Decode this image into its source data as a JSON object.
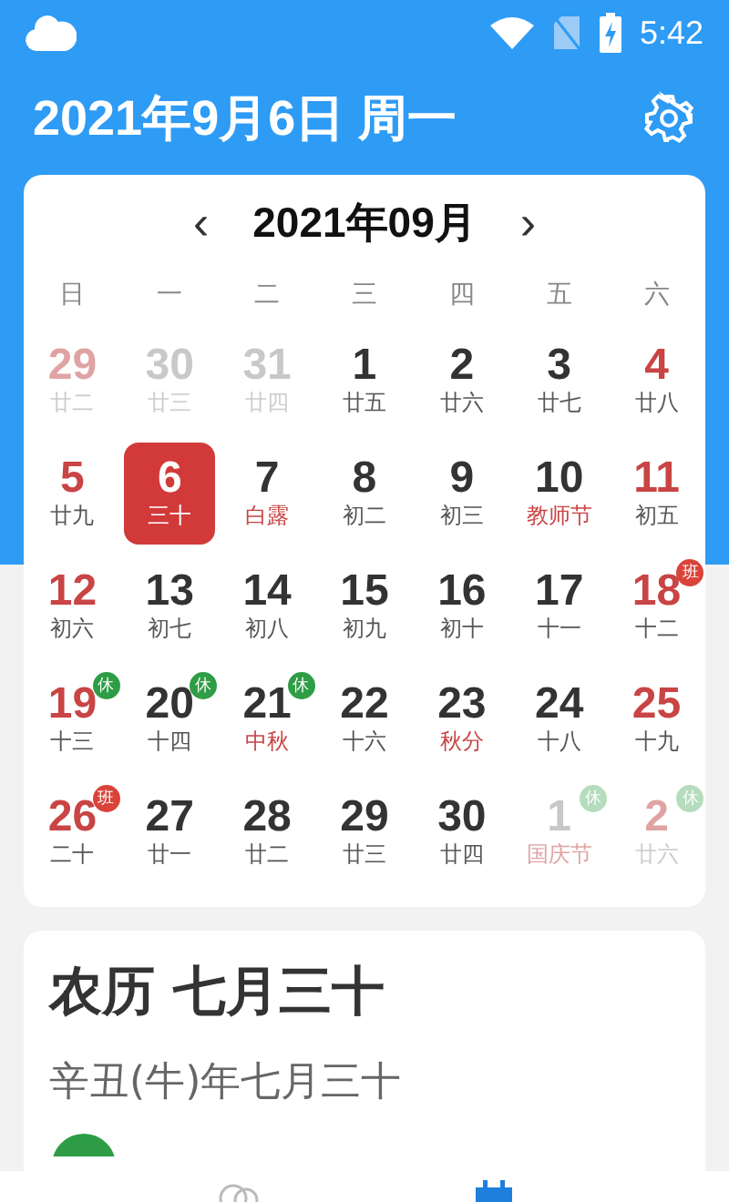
{
  "status_bar": {
    "time": "5:42"
  },
  "header": {
    "title": "2021年9月6日 周一"
  },
  "calendar": {
    "prev": "‹",
    "month": "2021年09月",
    "next": "›",
    "weekdays": [
      "日",
      "一",
      "二",
      "三",
      "四",
      "五",
      "六"
    ],
    "weeks": [
      [
        {
          "day": "29",
          "lunar": "廿二",
          "other_month": true,
          "holiday": true,
          "festival": false,
          "selected": false
        },
        {
          "day": "30",
          "lunar": "廿三",
          "other_month": true,
          "holiday": false,
          "festival": false,
          "selected": false
        },
        {
          "day": "31",
          "lunar": "廿四",
          "other_month": true,
          "holiday": false,
          "festival": false,
          "selected": false
        },
        {
          "day": "1",
          "lunar": "廿五",
          "other_month": false,
          "holiday": false,
          "festival": false,
          "selected": false
        },
        {
          "day": "2",
          "lunar": "廿六",
          "other_month": false,
          "holiday": false,
          "festival": false,
          "selected": false
        },
        {
          "day": "3",
          "lunar": "廿七",
          "other_month": false,
          "holiday": false,
          "festival": false,
          "selected": false
        },
        {
          "day": "4",
          "lunar": "廿八",
          "other_month": false,
          "holiday": true,
          "festival": false,
          "selected": false
        }
      ],
      [
        {
          "day": "5",
          "lunar": "廿九",
          "other_month": false,
          "holiday": true,
          "festival": false,
          "selected": false
        },
        {
          "day": "6",
          "lunar": "三十",
          "other_month": false,
          "holiday": false,
          "festival": false,
          "selected": true
        },
        {
          "day": "7",
          "lunar": "白露",
          "other_month": false,
          "holiday": false,
          "festival": true,
          "selected": false
        },
        {
          "day": "8",
          "lunar": "初二",
          "other_month": false,
          "holiday": false,
          "festival": false,
          "selected": false
        },
        {
          "day": "9",
          "lunar": "初三",
          "other_month": false,
          "holiday": false,
          "festival": false,
          "selected": false
        },
        {
          "day": "10",
          "lunar": "教师节",
          "other_month": false,
          "holiday": false,
          "festival": true,
          "selected": false
        },
        {
          "day": "11",
          "lunar": "初五",
          "other_month": false,
          "holiday": true,
          "festival": false,
          "selected": false
        }
      ],
      [
        {
          "day": "12",
          "lunar": "初六",
          "other_month": false,
          "holiday": true,
          "festival": false,
          "selected": false
        },
        {
          "day": "13",
          "lunar": "初七",
          "other_month": false,
          "holiday": false,
          "festival": false,
          "selected": false
        },
        {
          "day": "14",
          "lunar": "初八",
          "other_month": false,
          "holiday": false,
          "festival": false,
          "selected": false
        },
        {
          "day": "15",
          "lunar": "初九",
          "other_month": false,
          "holiday": false,
          "festival": false,
          "selected": false
        },
        {
          "day": "16",
          "lunar": "初十",
          "other_month": false,
          "holiday": false,
          "festival": false,
          "selected": false
        },
        {
          "day": "17",
          "lunar": "十一",
          "other_month": false,
          "holiday": false,
          "festival": false,
          "selected": false
        },
        {
          "day": "18",
          "lunar": "十二",
          "other_month": false,
          "holiday": true,
          "festival": false,
          "selected": false,
          "badge": {
            "label": "班",
            "kind": "work"
          }
        }
      ],
      [
        {
          "day": "19",
          "lunar": "十三",
          "other_month": false,
          "holiday": true,
          "festival": false,
          "selected": false,
          "badge": {
            "label": "休",
            "kind": "rest"
          }
        },
        {
          "day": "20",
          "lunar": "十四",
          "other_month": false,
          "holiday": false,
          "festival": false,
          "selected": false,
          "badge": {
            "label": "休",
            "kind": "rest"
          }
        },
        {
          "day": "21",
          "lunar": "中秋",
          "other_month": false,
          "holiday": false,
          "festival": true,
          "selected": false,
          "badge": {
            "label": "休",
            "kind": "rest"
          }
        },
        {
          "day": "22",
          "lunar": "十六",
          "other_month": false,
          "holiday": false,
          "festival": false,
          "selected": false
        },
        {
          "day": "23",
          "lunar": "秋分",
          "other_month": false,
          "holiday": false,
          "festival": true,
          "selected": false
        },
        {
          "day": "24",
          "lunar": "十八",
          "other_month": false,
          "holiday": false,
          "festival": false,
          "selected": false
        },
        {
          "day": "25",
          "lunar": "十九",
          "other_month": false,
          "holiday": true,
          "festival": false,
          "selected": false
        }
      ],
      [
        {
          "day": "26",
          "lunar": "二十",
          "other_month": false,
          "holiday": true,
          "festival": false,
          "selected": false,
          "badge": {
            "label": "班",
            "kind": "work"
          }
        },
        {
          "day": "27",
          "lunar": "廿一",
          "other_month": false,
          "holiday": false,
          "festival": false,
          "selected": false
        },
        {
          "day": "28",
          "lunar": "廿二",
          "other_month": false,
          "holiday": false,
          "festival": false,
          "selected": false
        },
        {
          "day": "29",
          "lunar": "廿三",
          "other_month": false,
          "holiday": false,
          "festival": false,
          "selected": false
        },
        {
          "day": "30",
          "lunar": "廿四",
          "other_month": false,
          "holiday": false,
          "festival": false,
          "selected": false
        },
        {
          "day": "1",
          "lunar": "国庆节",
          "other_month": true,
          "holiday": false,
          "festival": true,
          "selected": false,
          "badge": {
            "label": "休",
            "kind": "rest"
          }
        },
        {
          "day": "2",
          "lunar": "廿六",
          "other_month": true,
          "holiday": true,
          "festival": false,
          "selected": false,
          "badge": {
            "label": "休",
            "kind": "rest"
          }
        }
      ]
    ]
  },
  "lunar_card": {
    "title": "农历 七月三十",
    "subtitle": "辛丑(牛)年七月三十"
  },
  "bottom_nav": [
    {
      "kind": "explore",
      "selected": false
    },
    {
      "kind": "calendar",
      "selected": true
    }
  ]
}
